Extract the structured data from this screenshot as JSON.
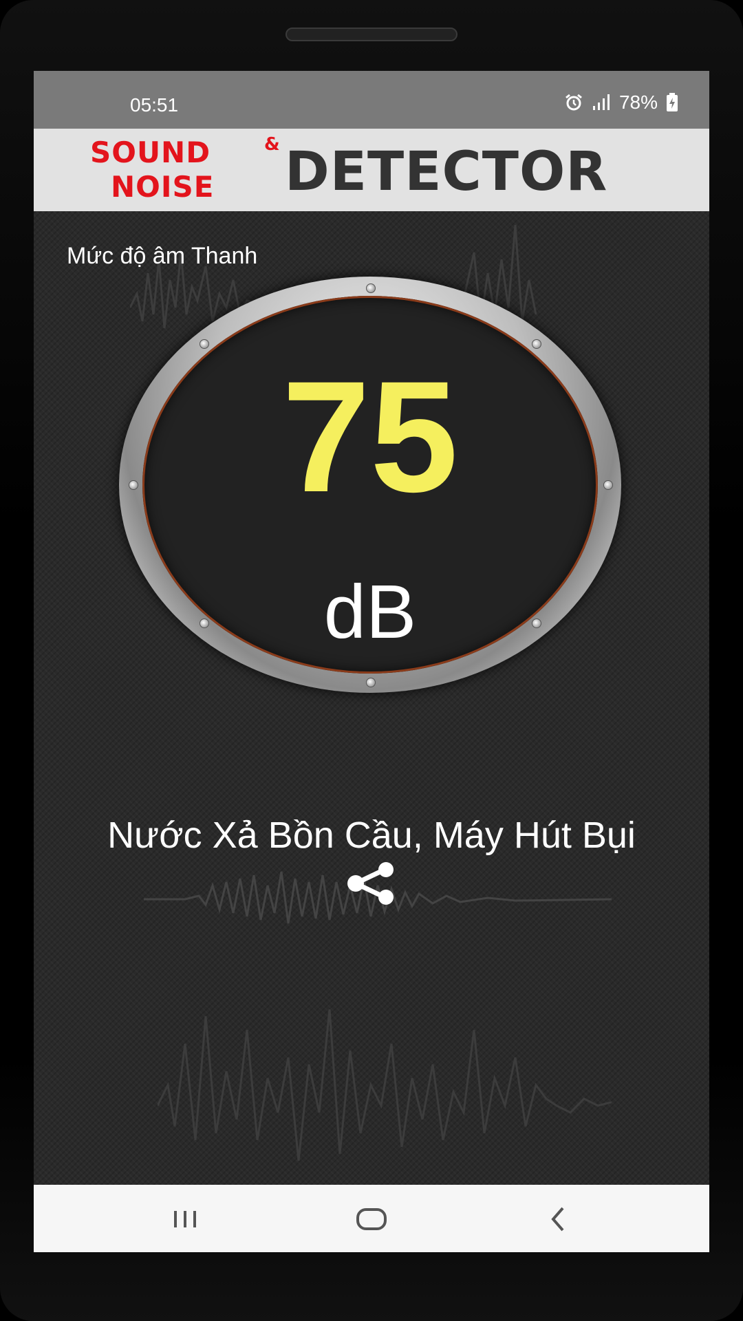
{
  "status_bar": {
    "time": "05:51",
    "battery": "78%"
  },
  "header": {
    "logo_sound": "SOUND",
    "logo_amp": "&",
    "logo_noise": "NOISE",
    "logo_detector": "DETECTOR"
  },
  "meter": {
    "label": "Mức độ âm Thanh",
    "value": "75",
    "unit": "dB"
  },
  "description": "Nước Xả Bồn Cầu, Máy Hút Bụi",
  "icons": {
    "alarm": "alarm-icon",
    "signal": "signal-icon",
    "battery": "battery-charging-icon",
    "share": "share-icon",
    "nav_recents": "recents-icon",
    "nav_home": "home-icon",
    "nav_back": "back-icon"
  },
  "colors": {
    "value": "#f5ef5e",
    "logo_red": "#e3141c",
    "logo_dark": "#333333",
    "status_bar": "#7a7a7a",
    "background": "#2a2a2a"
  }
}
